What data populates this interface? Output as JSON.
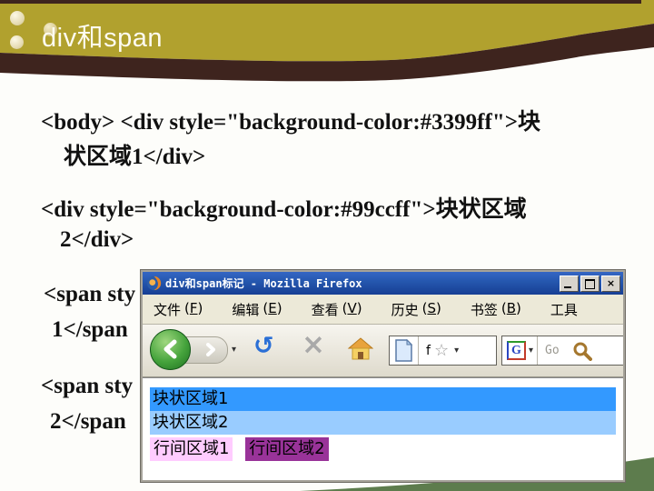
{
  "slide": {
    "title": "div和span",
    "code_lines": {
      "b1l1": "<body> <div style=\"background-color:#3399ff\">块",
      "b1l2": "状区域1</div>",
      "b2l1": "<div style=\"background-color:#99ccff\">块状区域",
      "b2l2": "2</div>",
      "b3l1": "<span sty",
      "b3l2": "1</span",
      "b4l1": "<span sty",
      "b4l2": "2</span"
    },
    "colors": {
      "header_olive": "#b1a12e",
      "header_brown": "#3e241e",
      "footer_green": "#5d7c4d",
      "title_text": "#fdfbf0"
    }
  },
  "browser": {
    "title": "div和span标记 - Mozilla Firefox",
    "menu": {
      "paren_open": "(",
      "paren_close": ")",
      "items": [
        {
          "label": "文件",
          "key": "F"
        },
        {
          "label": "编辑",
          "key": "E"
        },
        {
          "label": "查看",
          "key": "V"
        },
        {
          "label": "历史",
          "key": "S"
        },
        {
          "label": "书签",
          "key": "B"
        },
        {
          "label": "工具",
          "key": ""
        }
      ]
    },
    "toolbar": {
      "address_text": "f",
      "go_label": "Go"
    },
    "icons": {
      "refresh_glyph": "↻",
      "stop_glyph": "×",
      "star_glyph": "☆",
      "caret_glyph": "▾"
    },
    "content": {
      "rows": [
        {
          "type": "div",
          "text": "块状区域1",
          "bg": "#3399ff"
        },
        {
          "type": "div",
          "text": "块状区域2",
          "bg": "#99ccff"
        },
        {
          "type": "span",
          "text": "行间区域1",
          "bg": "#ffccff"
        },
        {
          "type": "span",
          "text": "行间区域2",
          "bg": "#993399"
        }
      ]
    }
  }
}
